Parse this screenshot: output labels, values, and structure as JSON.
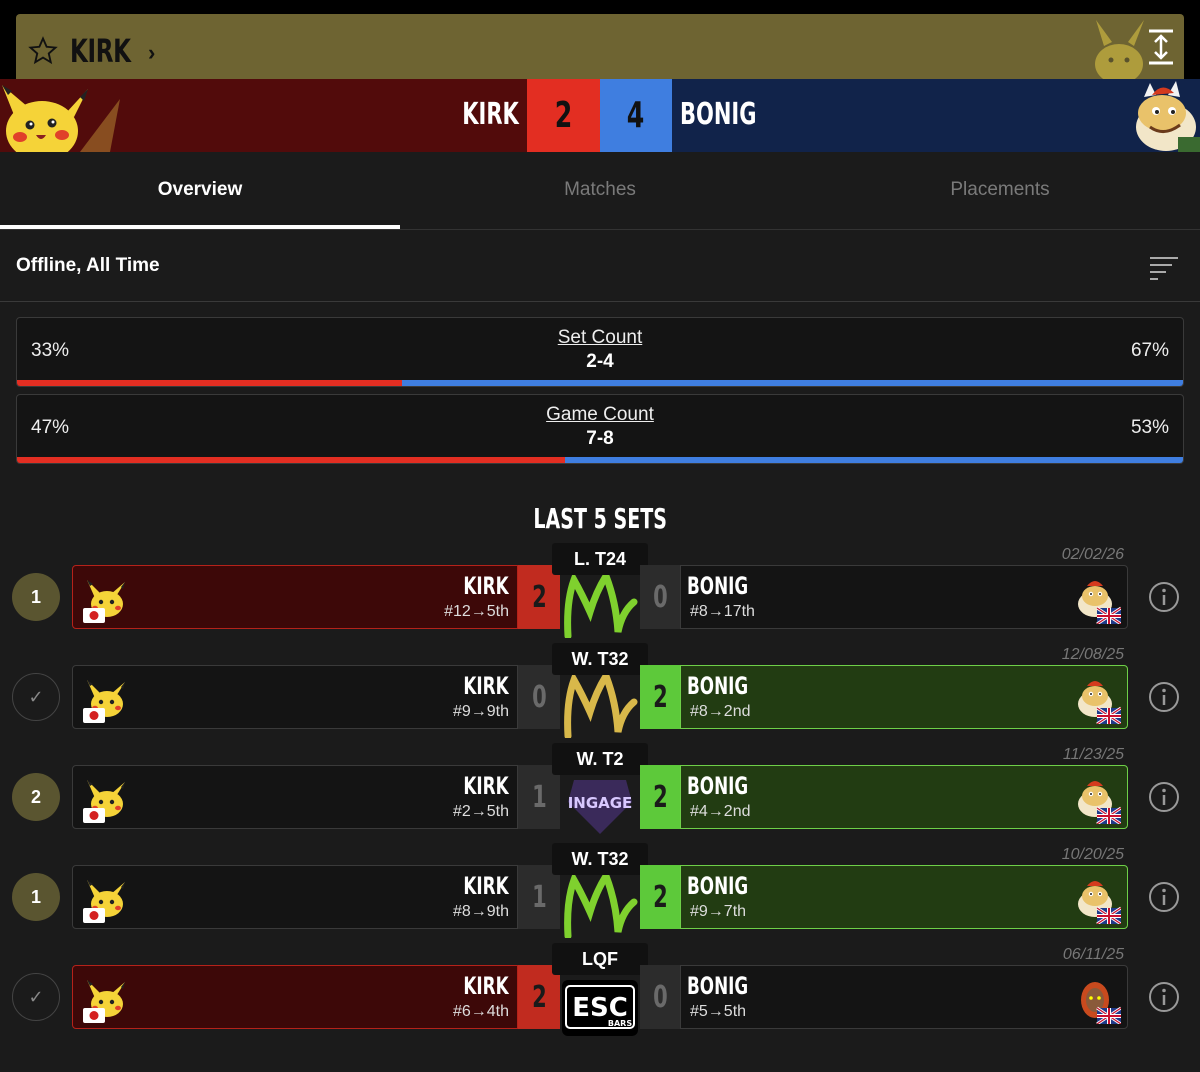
{
  "header": {
    "player_name": "KIRK",
    "left_player": "KIRK",
    "left_score": "2",
    "right_score": "4",
    "right_player": "BONIG"
  },
  "tabs": [
    {
      "label": "Overview",
      "active": true
    },
    {
      "label": "Matches",
      "active": false
    },
    {
      "label": "Placements",
      "active": false
    }
  ],
  "filter": {
    "label": "Offline, All Time"
  },
  "stats": [
    {
      "title": "Set Count",
      "value": "2-4",
      "left_pct": "33%",
      "right_pct": "67%",
      "left_fraction": 0.33
    },
    {
      "title": "Game Count",
      "value": "7-8",
      "left_pct": "47%",
      "right_pct": "53%",
      "left_fraction": 0.47
    }
  ],
  "section_title": "LAST 5 SETS",
  "colors": {
    "red": "#e32e22",
    "blue": "#3f7ee0",
    "green_win": "#5dc93a",
    "gold": "#6e6432"
  },
  "sets": [
    {
      "badge": "1",
      "badge_type": "number",
      "date": "02/02/26",
      "round": "L. T24",
      "left_name": "KIRK",
      "left_seed": "#12→5th",
      "left_score": "2",
      "left_win": true,
      "right_name": "BONIG",
      "right_seed": "#8→17th",
      "right_score": "0",
      "right_win": false,
      "logo": "m-green",
      "right_char": "bowser-jr-icon"
    },
    {
      "badge": "",
      "badge_type": "check",
      "date": "12/08/25",
      "round": "W. T32",
      "left_name": "KIRK",
      "left_seed": "#9→9th",
      "left_score": "0",
      "left_win": false,
      "right_name": "BONIG",
      "right_seed": "#8→2nd",
      "right_score": "2",
      "right_win": true,
      "logo": "m-gold",
      "right_char": "bowser-jr-icon"
    },
    {
      "badge": "2",
      "badge_type": "number",
      "date": "11/23/25",
      "round": "W. T2",
      "left_name": "KIRK",
      "left_seed": "#2→5th",
      "left_score": "1",
      "left_win": false,
      "right_name": "BONIG",
      "right_seed": "#4→2nd",
      "right_score": "2",
      "right_win": true,
      "logo": "ingage",
      "logo_text": "INGAGE",
      "right_char": "bowser-jr-icon"
    },
    {
      "badge": "1",
      "badge_type": "number",
      "date": "10/20/25",
      "round": "W. T32",
      "left_name": "KIRK",
      "left_seed": "#8→9th",
      "left_score": "1",
      "left_win": false,
      "right_name": "BONIG",
      "right_seed": "#9→7th",
      "right_score": "2",
      "right_win": true,
      "logo": "m-green",
      "right_char": "bowser-jr-icon"
    },
    {
      "badge": "",
      "badge_type": "check",
      "date": "06/11/25",
      "round": "LQF",
      "left_name": "KIRK",
      "left_seed": "#6→4th",
      "left_score": "2",
      "left_win": true,
      "right_name": "BONIG",
      "right_seed": "#5→5th",
      "right_score": "0",
      "right_win": false,
      "logo": "esc",
      "logo_text": "ESC",
      "logo_subtext": "BARS",
      "right_char": "ganondorf-icon"
    }
  ]
}
